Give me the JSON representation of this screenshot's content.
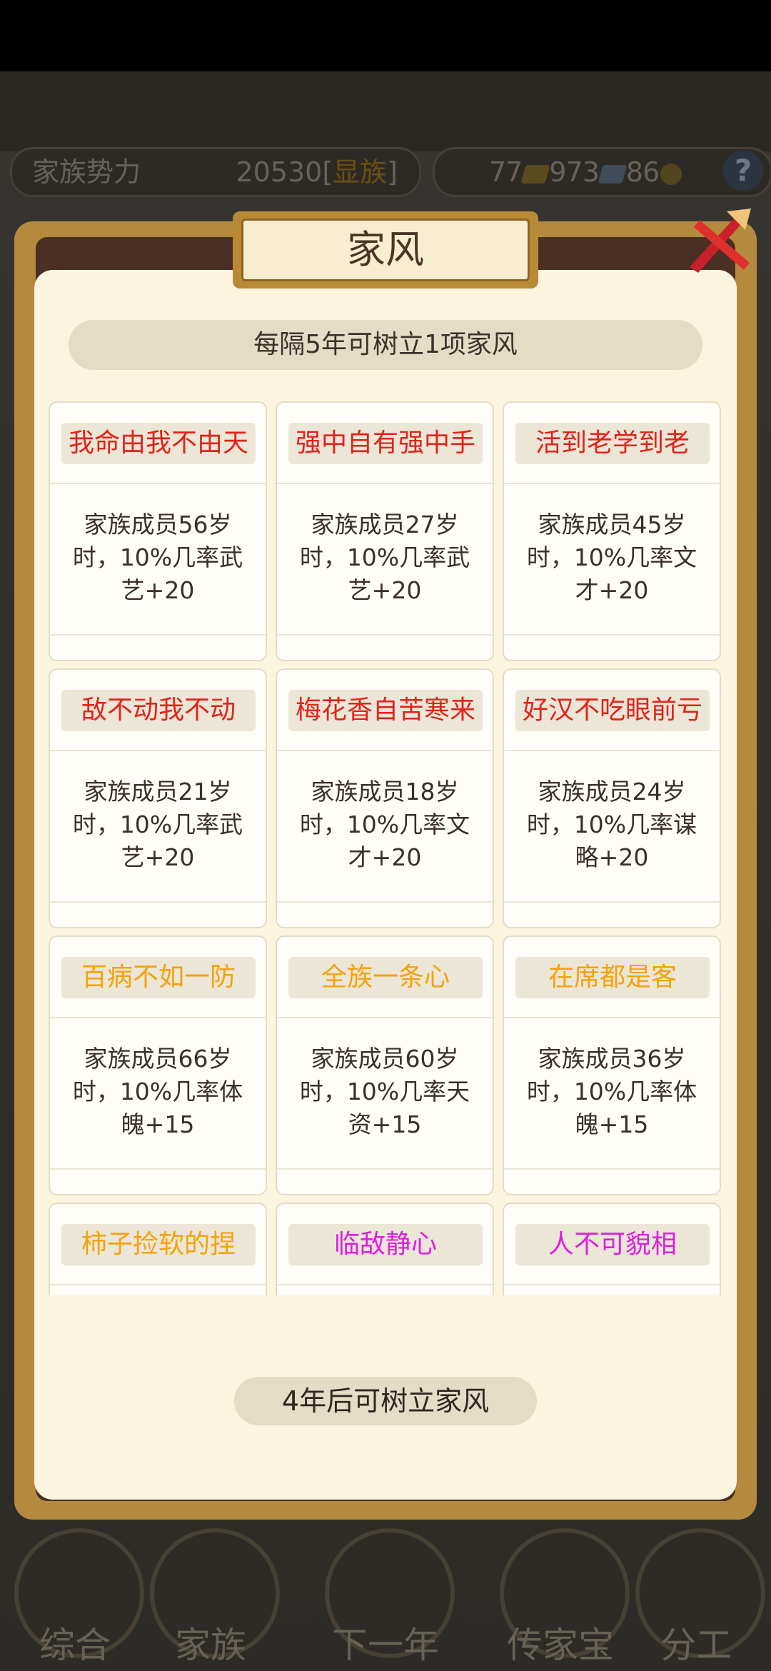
{
  "header": {
    "power_label": "家族势力",
    "power_value": "20530",
    "power_tag": "显族",
    "res_1": "77",
    "res_2": "973",
    "res_3": "86",
    "help": "?"
  },
  "dialog": {
    "title": "家风",
    "hint": "每隔5年可树立1项家风",
    "footer": "4年后可树立家风"
  },
  "cards": [
    {
      "title": "我命由我不由天",
      "desc": "家族成员56岁时，10%几率武艺+20",
      "color": "#e2231a"
    },
    {
      "title": "强中自有强中手",
      "desc": "家族成员27岁时，10%几率武艺+20",
      "color": "#e2231a"
    },
    {
      "title": "活到老学到老",
      "desc": "家族成员45岁时，10%几率文才+20",
      "color": "#e2231a"
    },
    {
      "title": "敌不动我不动",
      "desc": "家族成员21岁时，10%几率武艺+20",
      "color": "#e2231a"
    },
    {
      "title": "梅花香自苦寒来",
      "desc": "家族成员18岁时，10%几率文才+20",
      "color": "#e2231a"
    },
    {
      "title": "好汉不吃眼前亏",
      "desc": "家族成员24岁时，10%几率谋略+20",
      "color": "#e2231a"
    },
    {
      "title": "百病不如一防",
      "desc": "家族成员66岁时，10%几率体魄+15",
      "color": "#f5a20b"
    },
    {
      "title": "全族一条心",
      "desc": "家族成员60岁时，10%几率天资+15",
      "color": "#f5a20b"
    },
    {
      "title": "在席都是客",
      "desc": "家族成员36岁时，10%几率体魄+15",
      "color": "#f5a20b"
    },
    {
      "title": "柿子捡软的捏",
      "desc": "",
      "color": "#f5a20b"
    },
    {
      "title": "临敌静心",
      "desc": "",
      "color": "#e01ee0"
    },
    {
      "title": "人不可貌相",
      "desc": "",
      "color": "#e01ee0"
    }
  ],
  "nav": [
    {
      "label": "综合"
    },
    {
      "label": "家族"
    },
    {
      "label": "下一年"
    },
    {
      "label": "传家宝"
    },
    {
      "label": "分工"
    }
  ]
}
